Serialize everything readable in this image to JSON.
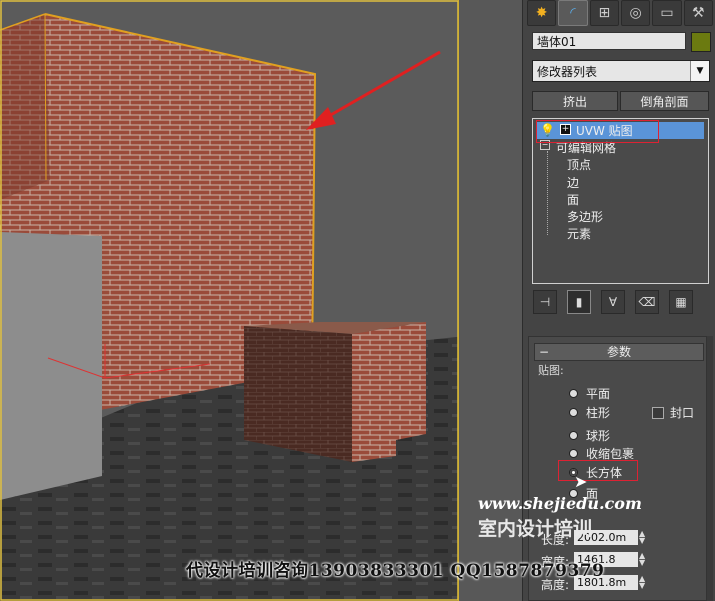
{
  "panel": {
    "tabs": [
      "create-icon",
      "modify-icon",
      "hierarchy-icon",
      "motion-icon",
      "display-icon",
      "utilities-icon"
    ],
    "object_name": "墙体01",
    "object_color": "#6b7a10",
    "modifier_list": "修改器列表",
    "buttons": {
      "extrude": "挤出",
      "bevel_profile": "倒角剖面"
    },
    "stack": {
      "uvw_map": "UVW 贴图",
      "editable_mesh": "可编辑网格",
      "sub": [
        "顶点",
        "边",
        "面",
        "多边形",
        "元素"
      ]
    },
    "params": {
      "title": "参数",
      "mapping_label": "贴图:",
      "planar": "平面",
      "cylindrical": "柱形",
      "cap": "封口",
      "spherical": "球形",
      "shrink_wrap": "收缩包裹",
      "box": "长方体",
      "face": "面",
      "length_label": "长度:",
      "length_value": "2002.0m",
      "width_label": "宽度:",
      "width_value": "1461.8",
      "height_label": "高度:",
      "height_value": "1801.8m"
    }
  },
  "watermark": {
    "site": "www.shejiedu.com",
    "school": "室内设计培训",
    "contact": "代设计培训咨询13903833301 QQ1587879379"
  },
  "colors": {
    "selection": "#5a94d8",
    "highlight_box": "#dd2233",
    "brick": "#9a4b3a"
  }
}
